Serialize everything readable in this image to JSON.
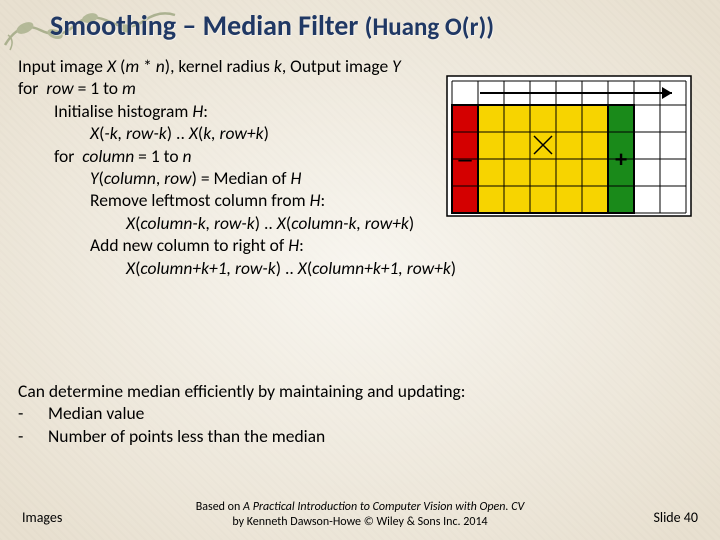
{
  "title": {
    "main": "Smoothing – Median Filter",
    "sub": "(Huang O(r))"
  },
  "algo": {
    "l1a": "Input image ",
    "l1b": "X",
    "l1c": " (",
    "l1d": "m",
    "l1e": " * ",
    "l1f": "n",
    "l1g": "), kernel radius ",
    "l1h": "k",
    "l1i": ", Output image ",
    "l1j": "Y",
    "l2a": "for  ",
    "l2b": "row",
    "l2c": " = 1 to ",
    "l2d": "m",
    "l3a": "Initialise histogram ",
    "l3b": "H",
    "l3c": ":",
    "l4a": "X",
    "l4b": "(",
    "l4c": "-k, row-k",
    "l4d": ") .. ",
    "l4e": "X",
    "l4f": "(",
    "l4g": "k, row+k",
    "l4h": ")",
    "l5a": "for  ",
    "l5b": "column",
    "l5c": " = 1 to ",
    "l5d": "n",
    "l6a": "Y",
    "l6b": "(",
    "l6c": "column",
    "l6d": ", ",
    "l6e": "row",
    "l6f": ") = Median of ",
    "l6g": "H",
    "l7a": "Remove leftmost column from ",
    "l7b": "H",
    "l7c": ":",
    "l8a": "X",
    "l8b": "(",
    "l8c": "column-k, row-k",
    "l8d": ") .. ",
    "l8e": "X",
    "l8f": "(",
    "l8g": "column-k, row+k",
    "l8h": ")",
    "l9a": "Add new column to right of ",
    "l9b": "H",
    "l9c": ":",
    "l10a": "X",
    "l10b": "(",
    "l10c": "column+k+1, row-k",
    "l10d": ") .. ",
    "l10e": "X",
    "l10f": "(",
    "l10g": "column+k+1, row+k",
    "l10h": ")"
  },
  "note": {
    "l1": "Can determine median efficiently by maintaining and updating:",
    "b1": "Median value",
    "b2": "Number of points less than the median"
  },
  "footer": {
    "left": "Images",
    "center_pre": "Based on  ",
    "center_book": "A Practical Introduction to Computer Vision with Open. CV",
    "center_post": "  by Kenneth Dawson-Howe © Wiley & Sons Inc. 2014",
    "right": "Slide 40"
  },
  "diagram": {
    "minus": "–",
    "plus": "+"
  }
}
